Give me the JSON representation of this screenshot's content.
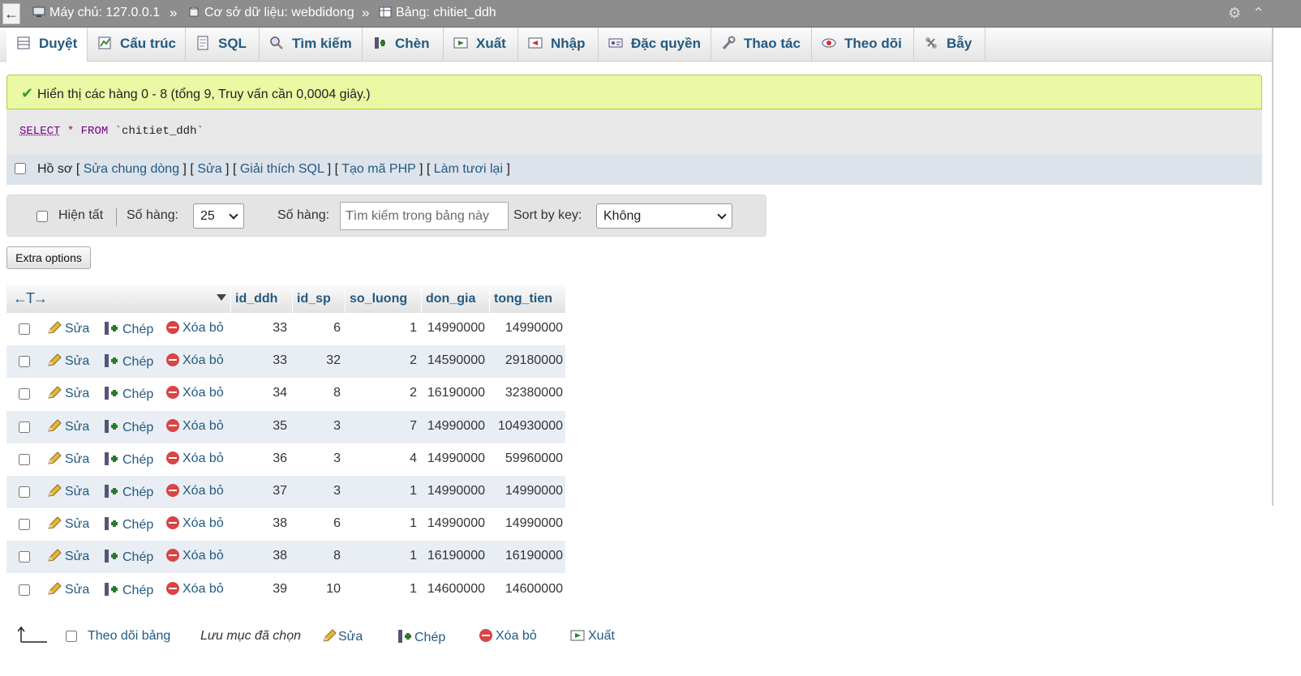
{
  "breadcrumb": {
    "back": "←",
    "server": "Máy chủ: 127.0.0.1",
    "sep": "»",
    "database": "Cơ sở dữ liệu: webdidong",
    "table": "Bảng: chitiet_ddh"
  },
  "tabs": [
    {
      "label": "Duyệt",
      "icon": "browse-icon"
    },
    {
      "label": "Cấu trúc",
      "icon": "structure-icon"
    },
    {
      "label": "SQL",
      "icon": "sql-icon"
    },
    {
      "label": "Tìm kiếm",
      "icon": "search-icon"
    },
    {
      "label": "Chèn",
      "icon": "insert-icon"
    },
    {
      "label": "Xuất",
      "icon": "export-icon"
    },
    {
      "label": "Nhập",
      "icon": "import-icon"
    },
    {
      "label": "Đặc quyền",
      "icon": "privileges-icon"
    },
    {
      "label": "Thao tác",
      "icon": "operations-icon"
    },
    {
      "label": "Theo dõi",
      "icon": "tracking-icon"
    },
    {
      "label": "Bẫy",
      "icon": "triggers-icon"
    }
  ],
  "message": "Hiển thị các hàng 0 - 8 (tổng 9, Truy vấn cần 0,0004 giây.)",
  "sql": {
    "select": "SELECT",
    "star": "*",
    "from": "FROM",
    "table": "`chitiet_ddh`"
  },
  "profile": {
    "label": "Hồ sơ",
    "links": [
      "Sửa chung dòng",
      "Sửa",
      "Giải thích SQL",
      "Tạo mã PHP",
      "Làm tươi lại"
    ]
  },
  "nav": {
    "show_all": "Hiện tất",
    "rows_label": "Số hàng:",
    "rows_value": "25",
    "filter_label": "Số hàng:",
    "search_placeholder": "Tìm kiếm trong bảng này",
    "sort_label": "Sort by key:",
    "sort_value": "Không"
  },
  "extra_options": "Extra options",
  "table": {
    "arrows": "←T→",
    "columns": [
      "id_ddh",
      "id_sp",
      "so_luong",
      "don_gia",
      "tong_tien"
    ],
    "actions": {
      "edit": "Sửa",
      "copy": "Chép",
      "delete": "Xóa bỏ"
    },
    "rows": [
      [
        "33",
        "6",
        "1",
        "14990000",
        "14990000"
      ],
      [
        "33",
        "32",
        "2",
        "14590000",
        "29180000"
      ],
      [
        "34",
        "8",
        "2",
        "16190000",
        "32380000"
      ],
      [
        "35",
        "3",
        "7",
        "14990000",
        "104930000"
      ],
      [
        "36",
        "3",
        "4",
        "14990000",
        "59960000"
      ],
      [
        "37",
        "3",
        "1",
        "14990000",
        "14990000"
      ],
      [
        "38",
        "6",
        "1",
        "14990000",
        "14990000"
      ],
      [
        "38",
        "8",
        "1",
        "16190000",
        "16190000"
      ],
      [
        "39",
        "10",
        "1",
        "14600000",
        "14600000"
      ]
    ]
  },
  "bottom": {
    "track": "Theo dõi bảng",
    "with_selected": "Lưu mục đã chọn",
    "edit": "Sửa",
    "copy": "Chép",
    "delete": "Xóa bỏ",
    "export": "Xuất"
  }
}
